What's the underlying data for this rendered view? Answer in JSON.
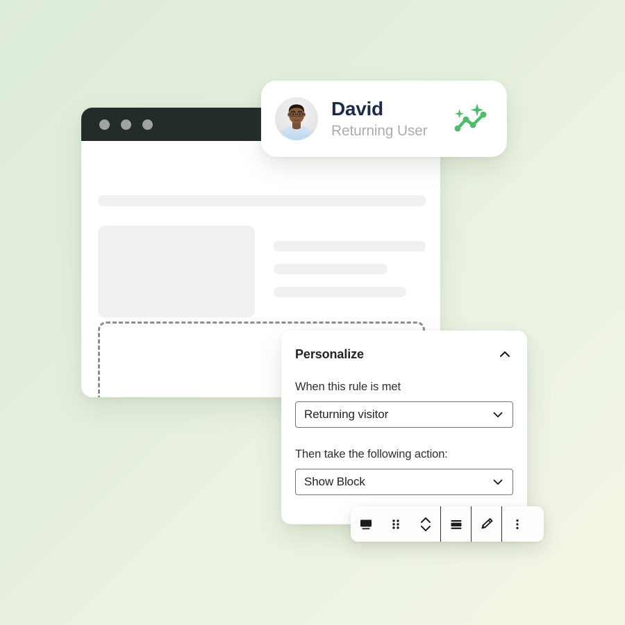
{
  "theme": {
    "bg_gradient_from": "#ddecd9",
    "bg_gradient_to": "#f2f6e5",
    "accent_green": "#4cbd6b",
    "name_navy": "#1a2a4a",
    "muted_gray": "#a8adb6",
    "titlebar_dark": "#242b2b",
    "skeleton_gray": "#f0f0f1",
    "dropzone_dash": "#8a8f8d"
  },
  "browser_window": {
    "window_dots": [
      "dot-close",
      "dot-minimize",
      "dot-maximize"
    ],
    "skeleton_blocks": [
      "top-bar",
      "image-placeholder",
      "text-line-1",
      "text-line-2",
      "text-line-3"
    ],
    "dropzone_label": ""
  },
  "profile_card": {
    "avatar_alt": "user-avatar-photo",
    "name": "David",
    "status": "Returning User",
    "insight_icon": "trending-sparkle-icon"
  },
  "personalize_panel": {
    "title": "Personalize",
    "collapse_icon": "chevron-up-icon",
    "rule": {
      "label": "When this rule is met",
      "value": "Returning visitor",
      "chevron_icon": "chevron-down-icon",
      "options": [
        "Returning visitor"
      ]
    },
    "action": {
      "label": "Then take the following action:",
      "value": "Show Block",
      "chevron_icon": "chevron-down-icon",
      "options": [
        "Show Block"
      ]
    }
  },
  "block_toolbar": {
    "buttons": [
      {
        "name": "device-preview-button",
        "icon": "monitor-icon"
      },
      {
        "name": "drag-handle-button",
        "icon": "drag-dots-icon"
      },
      {
        "name": "move-updown-button",
        "icon": "chevron-up-down-icon"
      },
      {
        "name": "layout-button",
        "icon": "layout-rows-icon"
      },
      {
        "name": "edit-button",
        "icon": "pencil-icon"
      },
      {
        "name": "more-options-button",
        "icon": "vertical-dots-icon"
      }
    ]
  }
}
